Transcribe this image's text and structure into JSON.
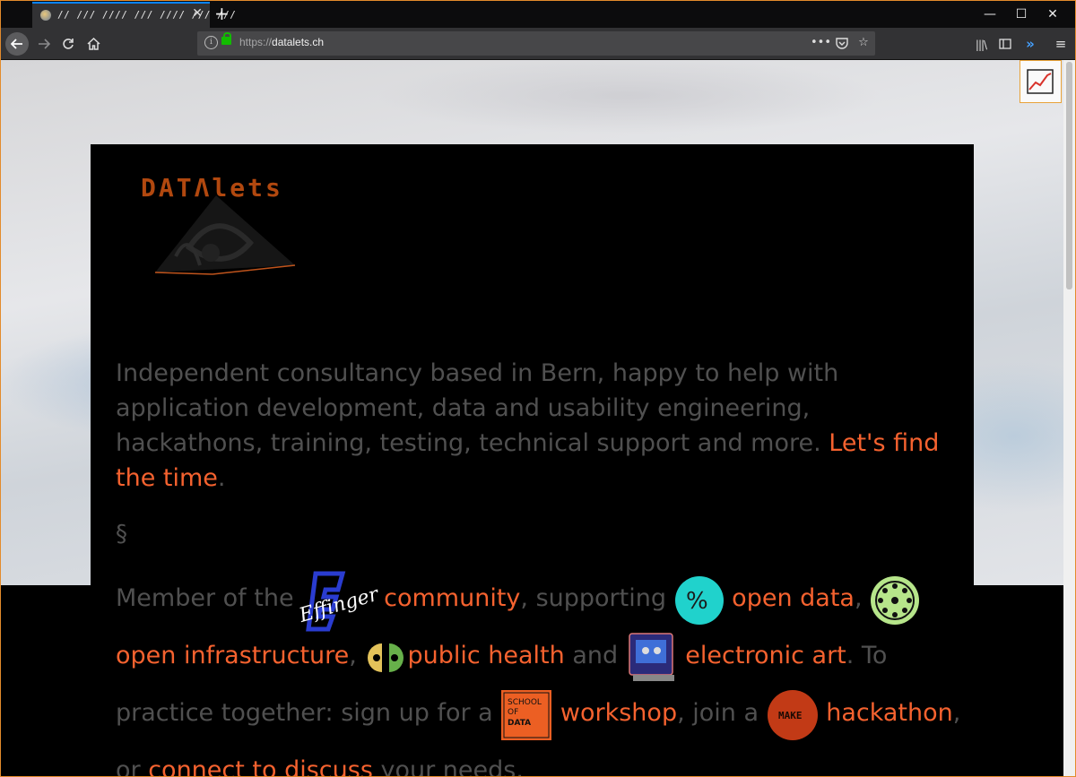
{
  "browser": {
    "tab_title": "// /// //// /// //// /// ///",
    "url_protocol": "https://",
    "url_host": "datalets.ch",
    "icons": [
      "back-arrow-icon",
      "forward-arrow-icon",
      "reload-icon",
      "home-icon",
      "info-icon",
      "lock-icon",
      "page-actions-icon",
      "pocket-icon",
      "bookmark-star-icon",
      "library-icon",
      "sidebar-icon",
      "extensions-icon",
      "menu-icon"
    ]
  },
  "page": {
    "logo_text": "DATΛlets",
    "intro_text": "Independent consultancy based in Bern, happy to help with application development, data and usability engineering, hackathons, training, testing, technical support and more. ",
    "intro_link": "Let's find the time",
    "intro_end": ".",
    "section_mark": "§",
    "members": {
      "t1": "Member of the ",
      "l1": "community",
      "t2": ", supporting ",
      "l2": "open data",
      "t3": ", ",
      "l3": "open infrastructure",
      "t4": ", ",
      "l4": "public health",
      "t5": " and ",
      "l5": "electronic art",
      "t6": ". To practice together: sign up for a ",
      "l6": "workshop",
      "t7": ", join a ",
      "l7": "hackathon",
      "t8": ", or ",
      "l8": "connect to discuss",
      "t9": " your needs."
    },
    "badges": {
      "effinger": "Effinger",
      "opendata": "%",
      "school_line1": "SCHOOL",
      "school_line2": "OF",
      "school_line3": "DATA",
      "make": "MAKE"
    }
  },
  "colors": {
    "link": "#f5622f",
    "text": "#505050",
    "logo": "#b1480f",
    "accent": "#0a84ff"
  }
}
